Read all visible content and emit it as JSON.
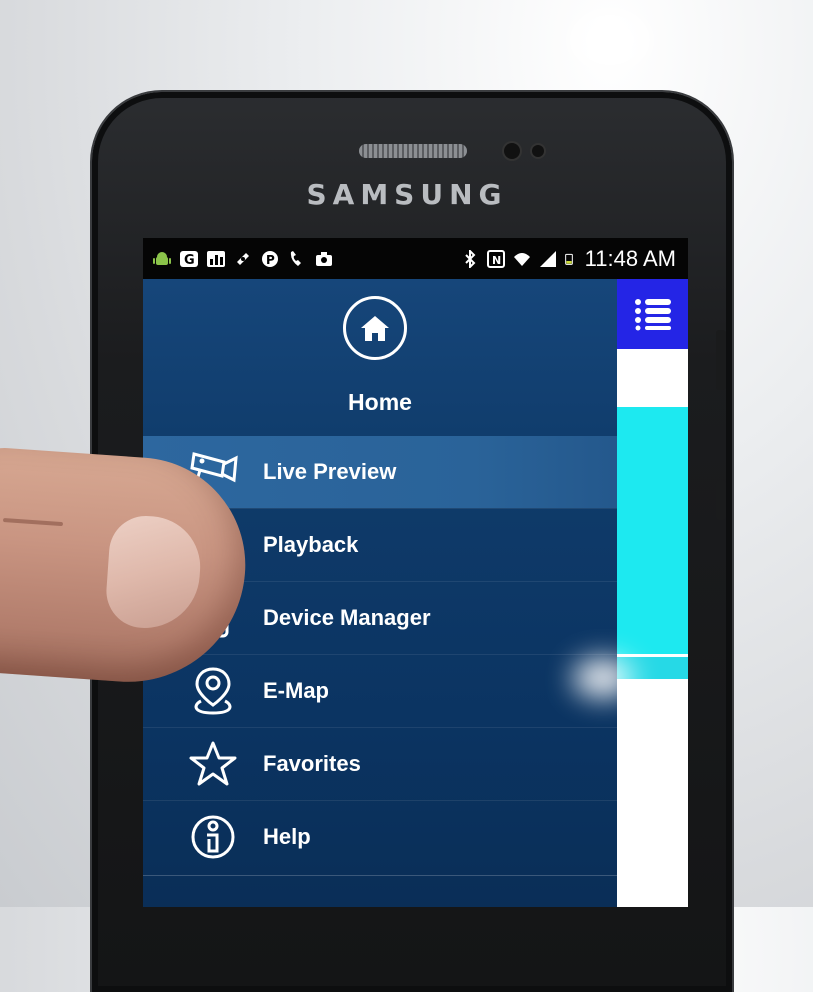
{
  "phone": {
    "brand": "SAMSUNG"
  },
  "status_bar": {
    "time": "11:48 AM",
    "icons_left": [
      "android-icon",
      "g-icon",
      "chart-icon",
      "link-icon",
      "p-icon",
      "call-icon",
      "camera-icon"
    ],
    "icons_right": [
      "bluetooth-icon",
      "nfc-icon",
      "wifi-icon",
      "signal-icon",
      "battery-icon"
    ]
  },
  "drawer": {
    "home_label": "Home",
    "items": [
      {
        "label": "Live Preview",
        "icon": "camera-icon",
        "active": true
      },
      {
        "label": "Playback",
        "icon": "film-icon",
        "active": false
      },
      {
        "label": "Device Manager",
        "icon": "device-icon",
        "active": false
      },
      {
        "label": "E-Map",
        "icon": "map-pin-icon",
        "active": false
      },
      {
        "label": "Favorites",
        "icon": "star-icon",
        "active": false
      },
      {
        "label": "Help",
        "icon": "info-icon",
        "active": false
      }
    ]
  },
  "colors": {
    "drawer_bg": "#0f3b6a",
    "active_item": "#2d679f",
    "top_strip": "#2425e6",
    "cyan_strip": "#1de9f0"
  }
}
